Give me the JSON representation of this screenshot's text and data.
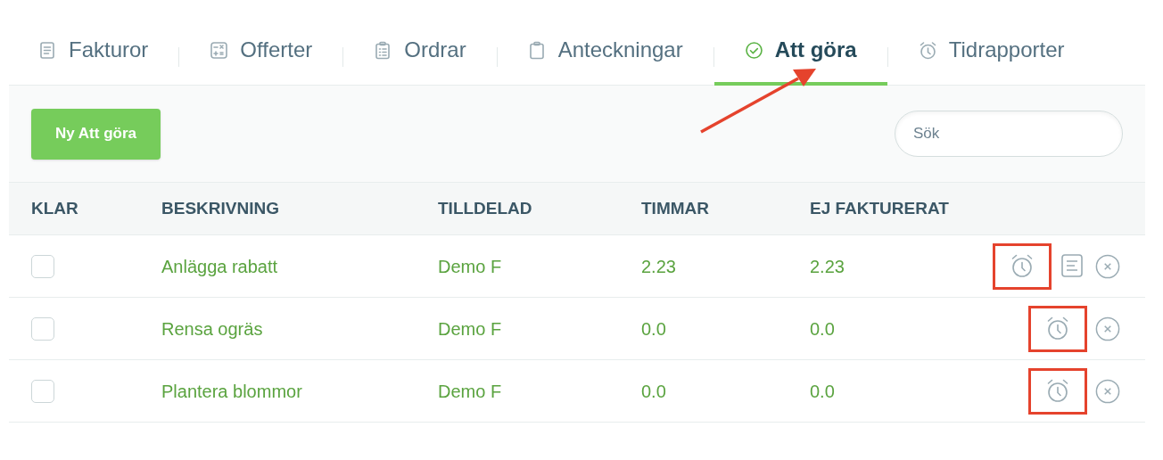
{
  "tabs": [
    {
      "label": "Fakturor",
      "kind": "document",
      "selected": false
    },
    {
      "label": "Offerter",
      "kind": "calculator",
      "selected": false
    },
    {
      "label": "Ordrar",
      "kind": "clipboard-list",
      "selected": false
    },
    {
      "label": "Anteckningar",
      "kind": "clipboard",
      "selected": false
    },
    {
      "label": "Att göra",
      "kind": "check-circle",
      "selected": true
    },
    {
      "label": "Tidrapporter",
      "kind": "alarm",
      "selected": false
    }
  ],
  "annotation_arrow": true,
  "toolbar": {
    "new_button": "Ny Att göra",
    "search": {
      "placeholder": "Sök"
    }
  },
  "table": {
    "columns": [
      "KLAR",
      "BESKRIVNING",
      "TILLDELAD",
      "TIMMAR",
      "EJ FAKTURERAT"
    ],
    "rows": [
      {
        "checked": false,
        "description": "Anlägga rabatt",
        "assigned": "Demo F",
        "hours": "2.23",
        "unbilled": "2.23",
        "actions": [
          {
            "kind": "timer",
            "highlighted": true
          },
          {
            "kind": "invoice",
            "highlighted": false
          },
          {
            "kind": "delete",
            "highlighted": false
          }
        ]
      },
      {
        "checked": false,
        "description": "Rensa ogräs",
        "assigned": "Demo F",
        "hours": "0.0",
        "unbilled": "0.0",
        "actions": [
          {
            "kind": "timer",
            "highlighted": true
          },
          {
            "kind": "delete",
            "highlighted": false
          }
        ]
      },
      {
        "checked": false,
        "description": "Plantera blommor",
        "assigned": "Demo F",
        "hours": "0.0",
        "unbilled": "0.0",
        "actions": [
          {
            "kind": "timer",
            "highlighted": true
          },
          {
            "kind": "delete",
            "highlighted": false
          }
        ]
      }
    ]
  }
}
